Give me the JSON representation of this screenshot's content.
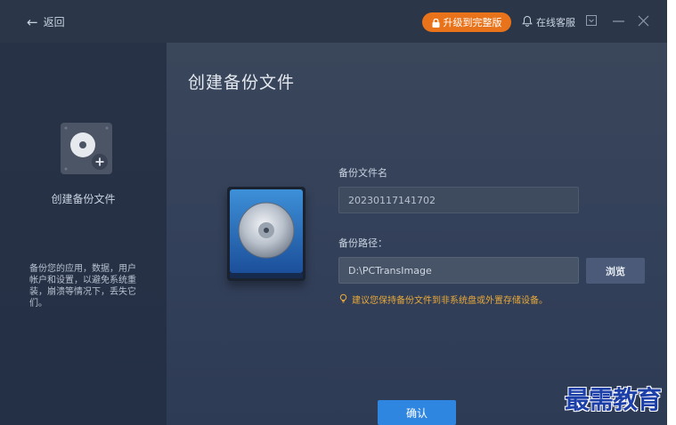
{
  "titlebar": {
    "back_label": "返回",
    "upgrade_label": "升级到完整版",
    "support_label": "在线客服"
  },
  "sidebar": {
    "title": "创建备份文件",
    "description": "备份您的应用，数据，用户帐户和设置，以避免系统重装，崩溃等情况下，丢失它们。"
  },
  "main": {
    "title": "创建备份文件",
    "filename_label": "备份文件名",
    "filename_value": "20230117141702",
    "path_label": "备份路径：",
    "path_value": "D:\\PCTransImage",
    "browse_label": "浏览",
    "tip": "建议您保持备份文件到非系统盘或外置存储设备。",
    "confirm_label": "确认"
  },
  "watermark": "最需教育",
  "colors": {
    "accent_orange": "#e8731a",
    "confirm_blue": "#2f86e0",
    "tip_yellow": "#e8a93a"
  }
}
